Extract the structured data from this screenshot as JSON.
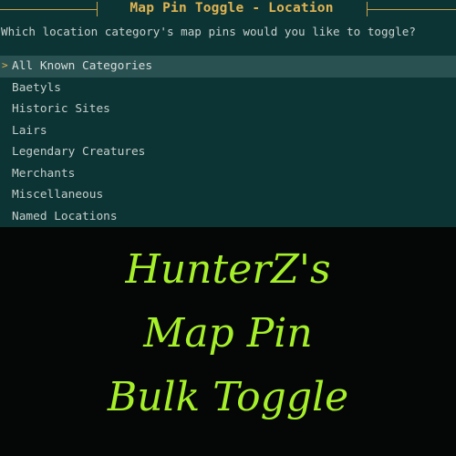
{
  "menu": {
    "title": "Map Pin Toggle - Location",
    "prompt": "Which location category's map pins would you like to toggle?",
    "cursor_glyph": ">",
    "selected_index": 0,
    "items": [
      {
        "label": "All Known Categories"
      },
      {
        "label": "Baetyls"
      },
      {
        "label": "Historic Sites"
      },
      {
        "label": "Lairs"
      },
      {
        "label": "Legendary Creatures"
      },
      {
        "label": "Merchants"
      },
      {
        "label": "Miscellaneous"
      },
      {
        "label": "Named Locations"
      }
    ]
  },
  "banner": {
    "line1": "HunterZ's",
    "line2": "Map Pin",
    "line3": "Bulk Toggle"
  },
  "colors": {
    "panel_background": "#0d3434",
    "selected_row": "#2a5151",
    "title_accent": "#e0b452",
    "banner_text": "#a6f02a",
    "banner_background": "#050606"
  }
}
